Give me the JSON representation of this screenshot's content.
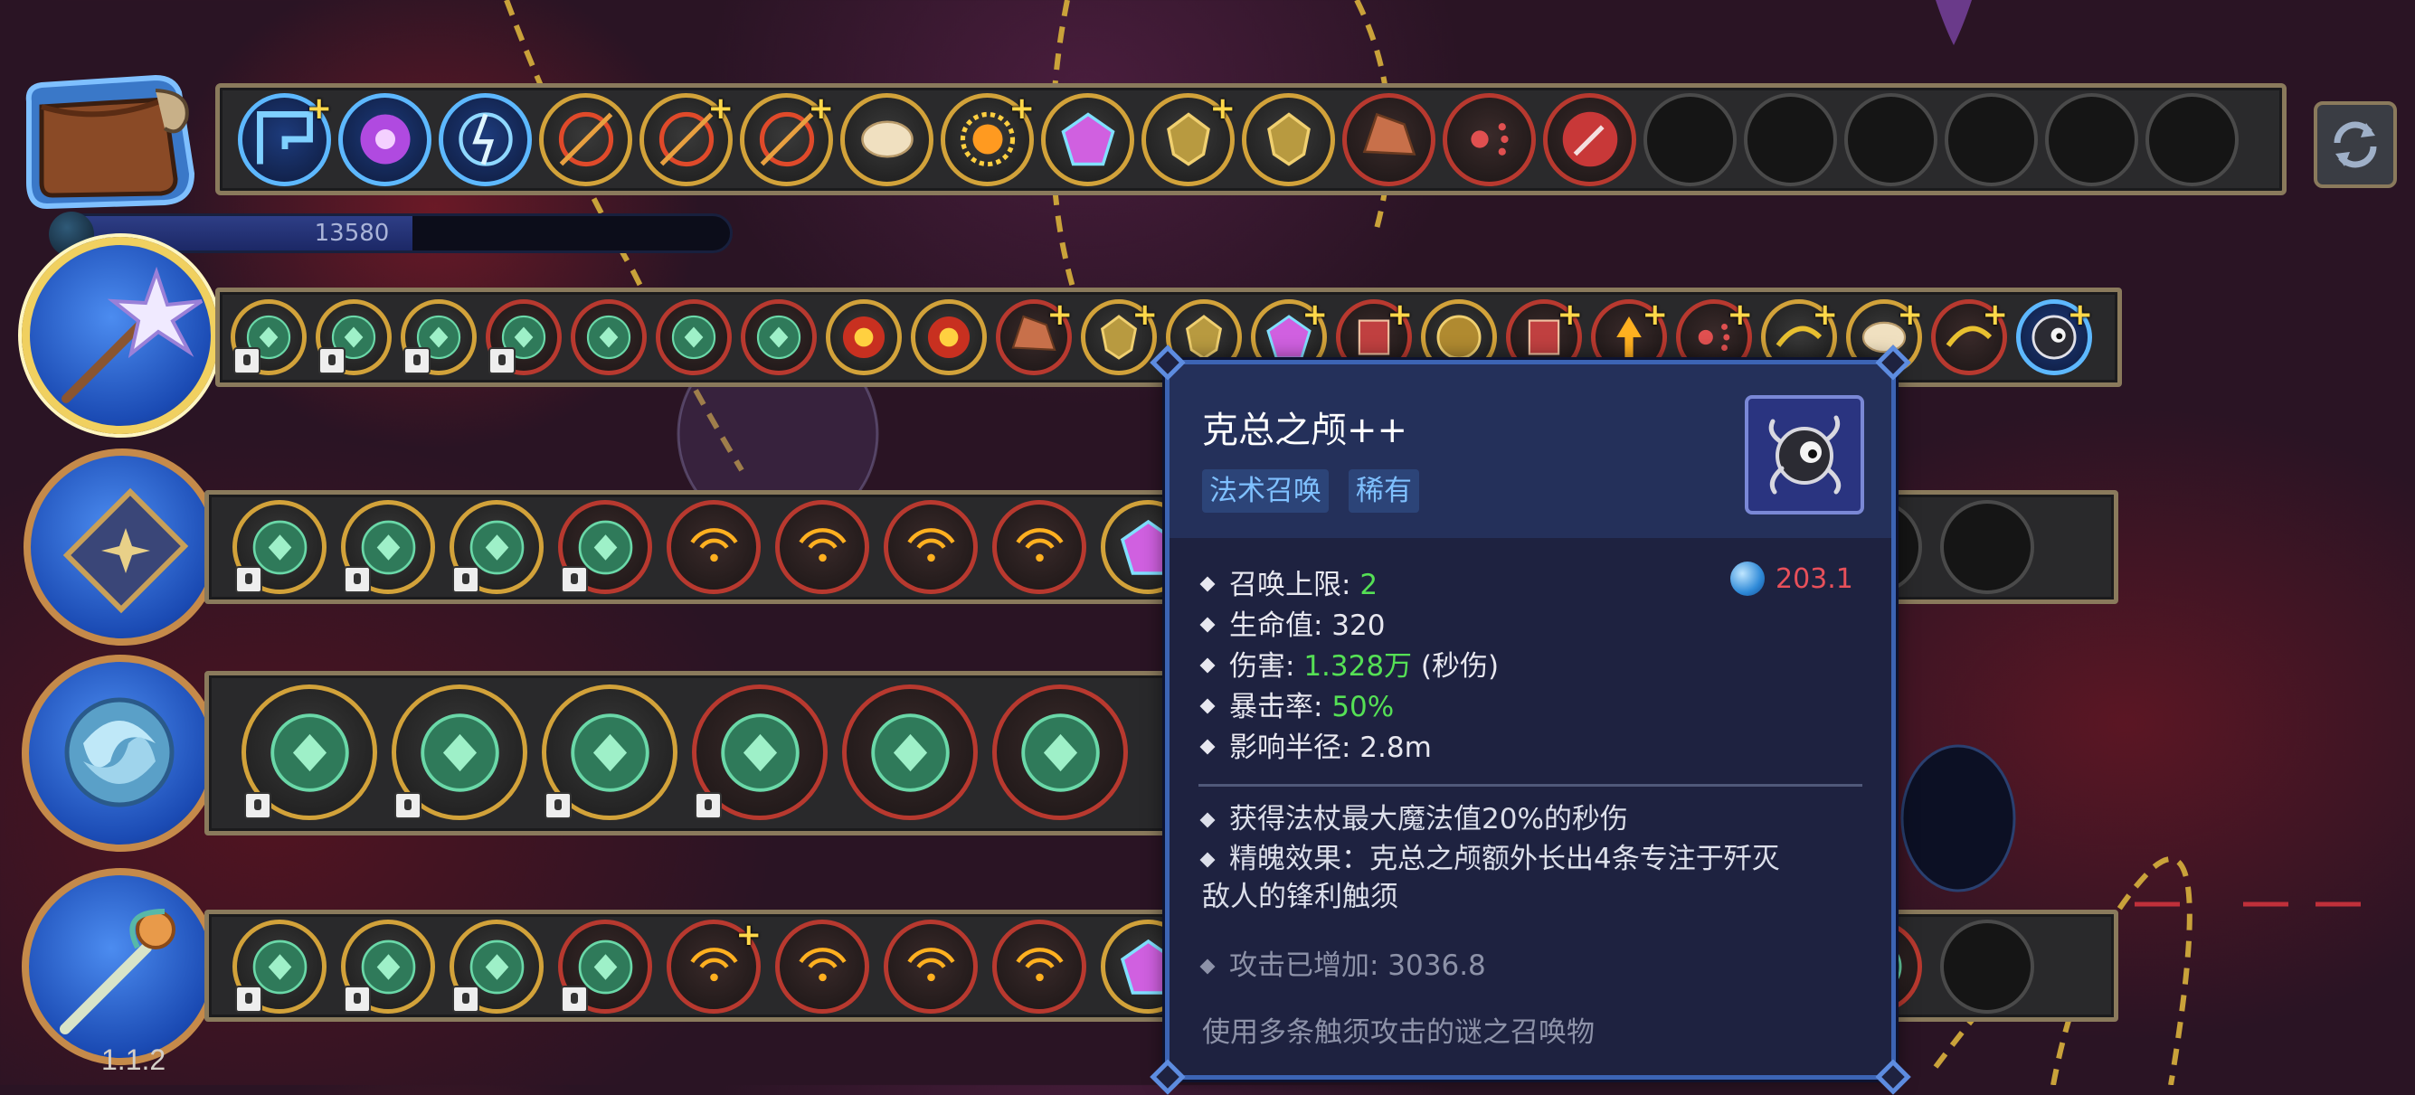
{
  "inventory": {
    "slots": [
      {
        "icon": "spiral-teleport-icon",
        "ring": "blue",
        "plus": true
      },
      {
        "icon": "purple-orb-icon",
        "ring": "blue",
        "plus": false
      },
      {
        "icon": "lightning-circle-icon",
        "ring": "blue",
        "plus": false
      },
      {
        "icon": "red-arrow-target-icon",
        "ring": "gold",
        "plus": false
      },
      {
        "icon": "red-arrow-target-icon",
        "ring": "gold",
        "plus": true
      },
      {
        "icon": "red-arrow-target-icon",
        "ring": "gold",
        "plus": true
      },
      {
        "icon": "bread-icon",
        "ring": "gold",
        "plus": false
      },
      {
        "icon": "sun-burst-icon",
        "ring": "gold",
        "plus": true
      },
      {
        "icon": "rainbow-crystal-icon",
        "ring": "gold",
        "plus": false
      },
      {
        "icon": "golden-shield-icon",
        "ring": "gold",
        "plus": true
      },
      {
        "icon": "golden-shield-icon",
        "ring": "gold",
        "plus": false
      },
      {
        "icon": "rock-icon",
        "ring": "red",
        "plus": false
      },
      {
        "icon": "scatter-shot-icon",
        "ring": "red",
        "plus": false
      },
      {
        "icon": "magic-wand-icon",
        "ring": "red",
        "plus": false
      },
      {
        "icon": "",
        "ring": "empty",
        "plus": false
      },
      {
        "icon": "",
        "ring": "empty",
        "plus": false
      },
      {
        "icon": "",
        "ring": "empty",
        "plus": false
      },
      {
        "icon": "",
        "ring": "empty",
        "plus": false
      },
      {
        "icon": "",
        "ring": "empty",
        "plus": false
      },
      {
        "icon": "",
        "ring": "empty",
        "plus": false
      }
    ]
  },
  "mana": {
    "value_text": "13580",
    "fill_fraction": 0.53
  },
  "version": "1.1.2",
  "tooltip": {
    "title": "克总之颅++",
    "tags": [
      "法术召唤",
      "稀有"
    ],
    "portrait_icon": "tentacle-skull-icon",
    "cost": "203.1",
    "stats": [
      {
        "label": "召唤上限: ",
        "value": "2",
        "suffix": ""
      },
      {
        "label": "生命值: 320",
        "value": "",
        "suffix": ""
      },
      {
        "label": "伤害: ",
        "value": "1.328万",
        "suffix": " (秒伤)"
      },
      {
        "label": "暴击率: ",
        "value": "50%",
        "suffix": ""
      },
      {
        "label": "影响半径: 2.8m",
        "value": "",
        "suffix": ""
      }
    ],
    "desc_1": "获得法杖最大魔法值20%的秒伤",
    "desc_2_line1": "精魄效果：克总之颅额外长出4条专注于歼灭",
    "desc_2_line2": "敌人的锋利触须",
    "attack_bonus": "攻击已增加: 3036.8",
    "flavor": "使用多条触须攻击的谜之召唤物"
  },
  "colors": {
    "gold_ring": "#d2a23a",
    "red_ring": "#b8392f",
    "blue_ring": "#5db8ff",
    "highlight_green": "#55e055",
    "cost_red": "#e8505a"
  }
}
